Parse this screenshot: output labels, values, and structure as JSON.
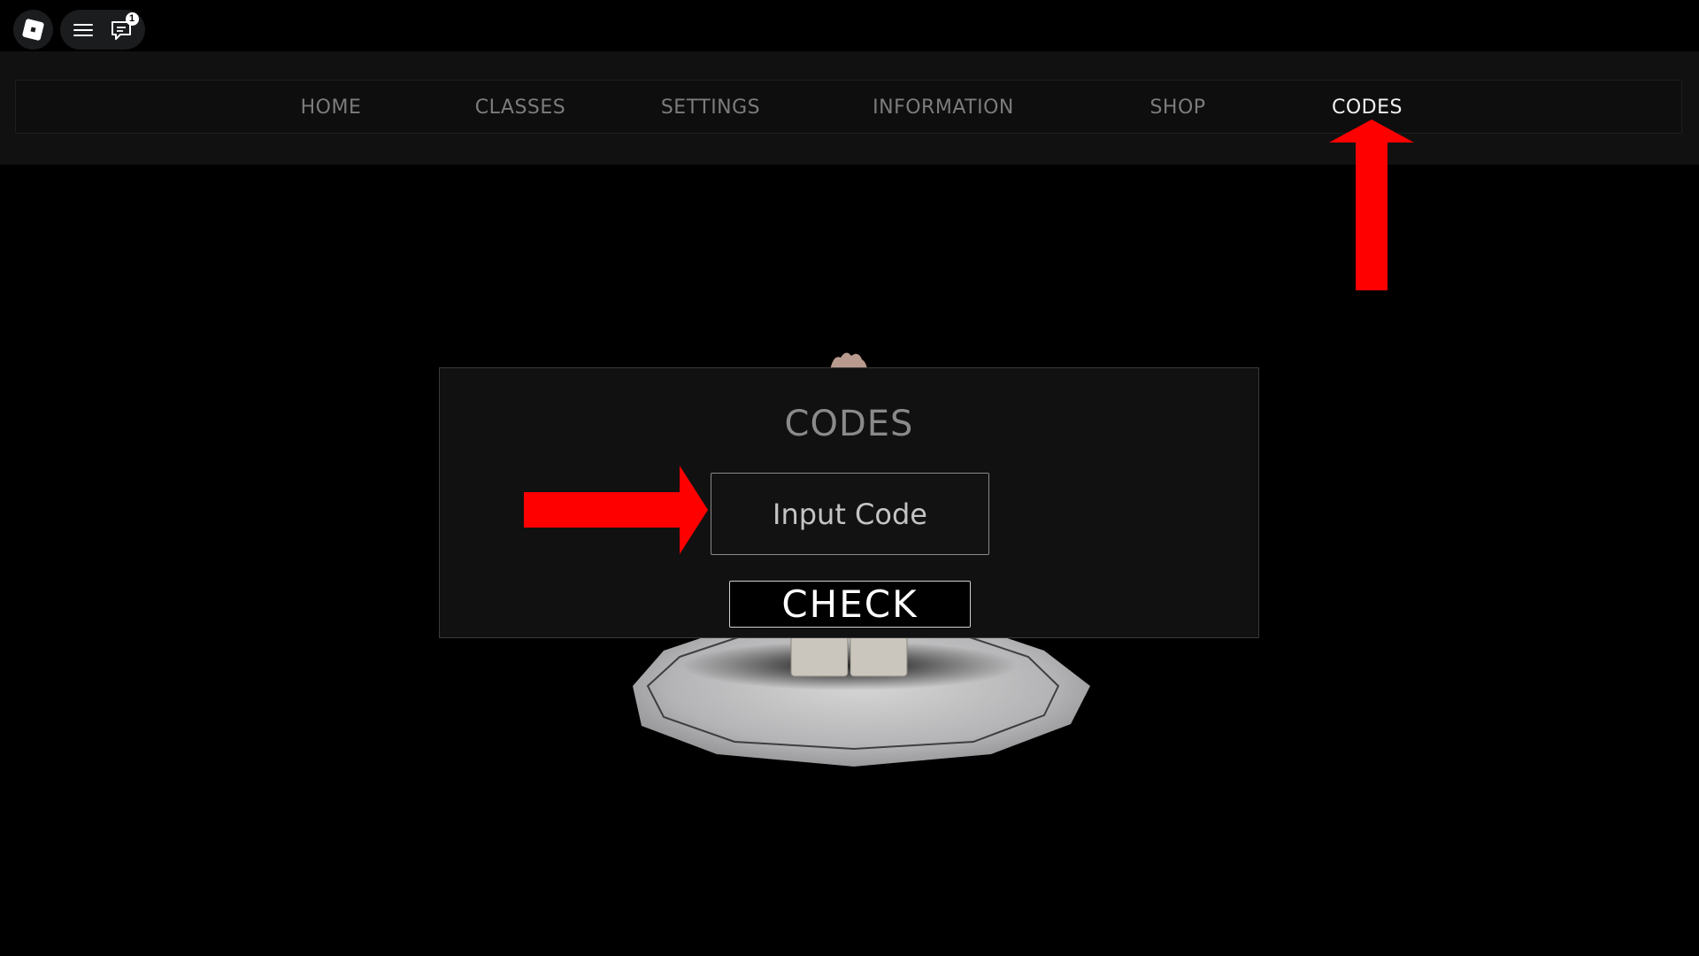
{
  "topbar": {
    "logo_icon": "roblox-logo-icon",
    "menu_icon": "hamburger-menu-icon",
    "chat_icon": "chat-icon",
    "chat_badge_count": "1"
  },
  "nav": {
    "items": [
      {
        "label": "HOME",
        "active": false
      },
      {
        "label": "CLASSES",
        "active": false
      },
      {
        "label": "SETTINGS",
        "active": false
      },
      {
        "label": "INFORMATION",
        "active": false
      },
      {
        "label": "SHOP",
        "active": false
      },
      {
        "label": "CODES",
        "active": true
      }
    ]
  },
  "codes_panel": {
    "title": "CODES",
    "input_placeholder": "Input Code",
    "input_value": "",
    "check_label": "CHECK"
  },
  "annotations": {
    "arrow_color": "#ff0000",
    "arrows": [
      "arrow-up-to-codes-tab",
      "arrow-right-to-code-input"
    ]
  },
  "colors": {
    "background": "#000000",
    "nav_band": "#111111",
    "nav_inactive": "#7c7c7c",
    "nav_active": "#f2f2f2",
    "panel_bg": "#111111",
    "panel_title": "#8a8a8a"
  }
}
